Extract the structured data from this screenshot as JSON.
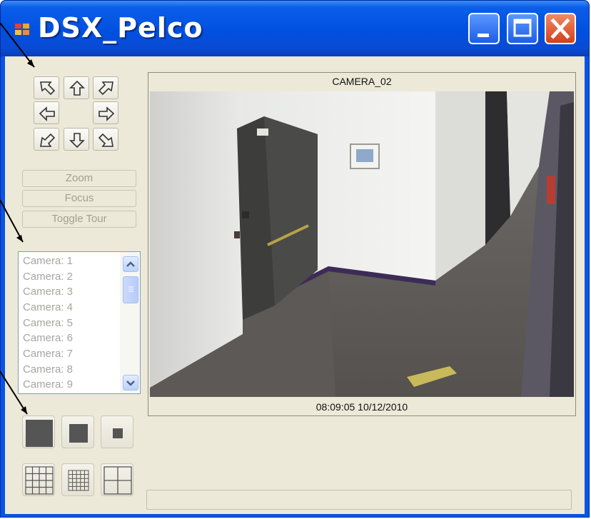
{
  "window": {
    "title": "DSX_Pelco",
    "controls": [
      "minimize-icon",
      "maximize-icon",
      "close-icon"
    ]
  },
  "ptz_controls": {
    "buttons": [
      "up-left",
      "up",
      "up-right",
      "left",
      "right",
      "down-left",
      "down",
      "down-right"
    ]
  },
  "action_buttons": {
    "zoom": "Zoom",
    "focus": "Focus",
    "toggle_tour": "Toggle Tour"
  },
  "camera_list": {
    "items": [
      "Camera: 1",
      "Camera: 2",
      "Camera: 3",
      "Camera: 4",
      "Camera: 5",
      "Camera: 6",
      "Camera: 7",
      "Camera: 8",
      "Camera: 9"
    ]
  },
  "view_size_buttons": [
    "large-view",
    "medium-view",
    "small-view"
  ],
  "grid_layout_buttons": [
    "grid-4x4",
    "grid-5x5",
    "grid-2x2"
  ],
  "camera_view": {
    "name": "CAMERA_02",
    "timestamp": "08:09:05 10/12/2010"
  },
  "colors": {
    "titlebar": "#0a54e4",
    "client": "#ece9d8",
    "close": "#d2411d",
    "disabled_text": "#a3a08f"
  }
}
